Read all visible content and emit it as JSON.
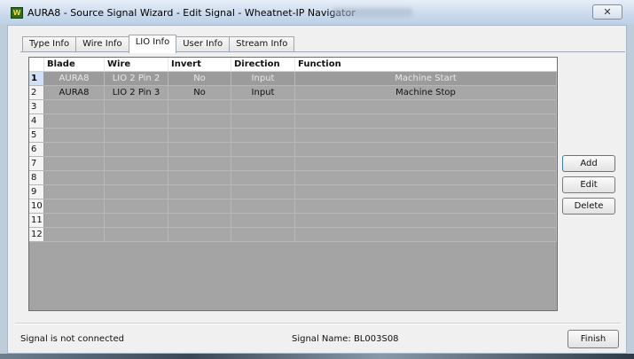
{
  "window": {
    "title": "AURA8 - Source Signal Wizard - Edit Signal - Wheatnet-IP Navigator",
    "icon": "wheatnet-logo-icon",
    "close_glyph": "✕"
  },
  "tabs": [
    {
      "label": "Type Info",
      "active": false
    },
    {
      "label": "Wire Info",
      "active": false
    },
    {
      "label": "LIO Info",
      "active": true
    },
    {
      "label": "User Info",
      "active": false
    },
    {
      "label": "Stream Info",
      "active": false
    }
  ],
  "grid": {
    "columns": [
      "",
      "Blade",
      "Wire",
      "Invert",
      "Direction",
      "Function"
    ],
    "rows": [
      {
        "num": "1",
        "blade": "AURA8",
        "wire": "LIO 2 Pin 2",
        "invert": "No",
        "direction": "Input",
        "function": "Machine Start"
      },
      {
        "num": "2",
        "blade": "AURA8",
        "wire": "LIO 2 Pin 3",
        "invert": "No",
        "direction": "Input",
        "function": "Machine Stop"
      },
      {
        "num": "3",
        "blade": "",
        "wire": "",
        "invert": "",
        "direction": "",
        "function": ""
      },
      {
        "num": "4",
        "blade": "",
        "wire": "",
        "invert": "",
        "direction": "",
        "function": ""
      },
      {
        "num": "5",
        "blade": "",
        "wire": "",
        "invert": "",
        "direction": "",
        "function": ""
      },
      {
        "num": "6",
        "blade": "",
        "wire": "",
        "invert": "",
        "direction": "",
        "function": ""
      },
      {
        "num": "7",
        "blade": "",
        "wire": "",
        "invert": "",
        "direction": "",
        "function": ""
      },
      {
        "num": "8",
        "blade": "",
        "wire": "",
        "invert": "",
        "direction": "",
        "function": ""
      },
      {
        "num": "9",
        "blade": "",
        "wire": "",
        "invert": "",
        "direction": "",
        "function": ""
      },
      {
        "num": "10",
        "blade": "",
        "wire": "",
        "invert": "",
        "direction": "",
        "function": ""
      },
      {
        "num": "11",
        "blade": "",
        "wire": "",
        "invert": "",
        "direction": "",
        "function": ""
      },
      {
        "num": "12",
        "blade": "",
        "wire": "",
        "invert": "",
        "direction": "",
        "function": ""
      }
    ]
  },
  "buttons": {
    "add": "Add",
    "edit": "Edit",
    "delete": "Delete",
    "finish": "Finish"
  },
  "status": {
    "connection": "Signal is not connected",
    "signal_name": "Signal Name:  BL003S08"
  }
}
